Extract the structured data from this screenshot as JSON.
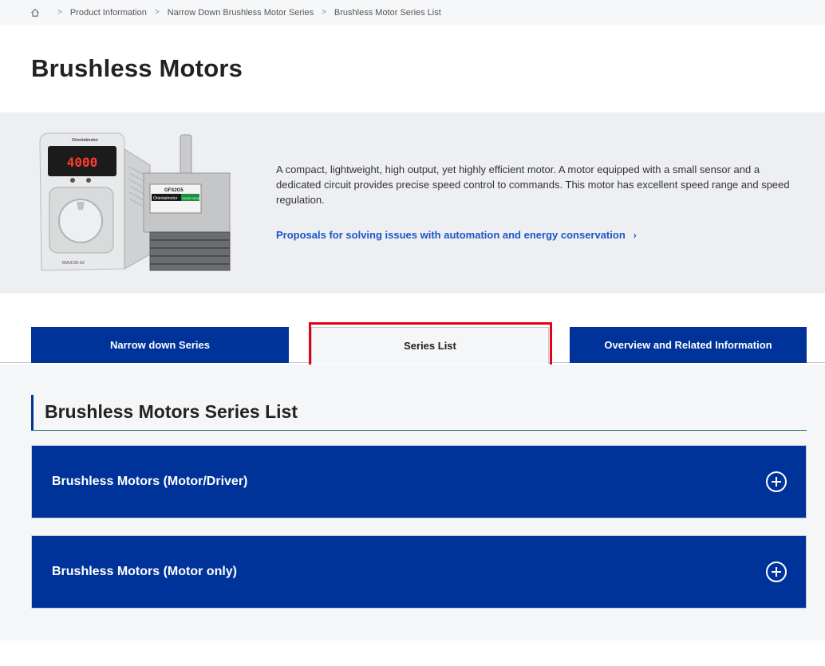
{
  "breadcrumb": {
    "home_icon": "home-icon",
    "items": [
      "Product Information",
      "Narrow Down Brushless Motor Series",
      "Brushless Motor Series List"
    ]
  },
  "page": {
    "title": "Brushless Motors"
  },
  "hero": {
    "description": "A compact, lightweight, high output, yet highly efficient motor. A motor equipped with a small sensor and a dedicated circuit provides precise speed control to commands. This motor has excellent speed range and speed regulation.",
    "link_label": "Proposals for solving issues with automation and energy conservation",
    "link_icon": "chevron-right-icon",
    "image": {
      "driver_display": "4000",
      "driver_brand": "Orientalmotor",
      "driver_model": "BMUD30-A2",
      "motor_model": "GFS2G5",
      "motor_brand": "Orientalmotor",
      "motor_badge": "GEAR HEAD"
    }
  },
  "tabs": [
    {
      "label": "Narrow down Series",
      "active": false
    },
    {
      "label": "Series List",
      "active": true
    },
    {
      "label": "Overview and Related Information",
      "active": false
    }
  ],
  "series_list": {
    "title": "Brushless Motors Series List",
    "items": [
      {
        "label": "Brushless Motors (Motor/Driver)",
        "icon": "plus-circle-icon"
      },
      {
        "label": "Brushless Motors (Motor only)",
        "icon": "plus-circle-icon"
      }
    ]
  },
  "colors": {
    "brand_blue": "#003399",
    "link_blue": "#1a56c8",
    "highlight_red": "#e60012"
  }
}
